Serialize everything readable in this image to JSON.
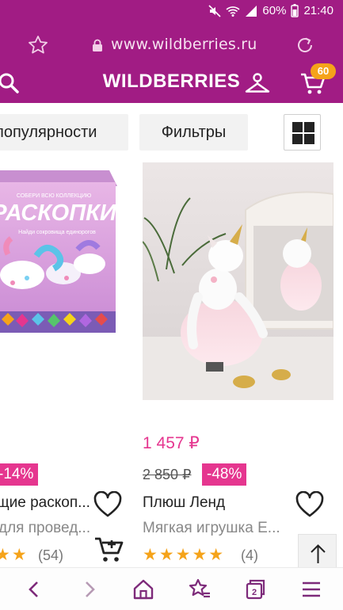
{
  "status_bar": {
    "battery": "60%",
    "time": "21:40"
  },
  "browser": {
    "url": "www.wildberries.ru"
  },
  "header": {
    "title": "WILDBERRIES",
    "cart_count": "60"
  },
  "controls": {
    "sort_label": "популярности",
    "filter_label": "Фильтры"
  },
  "products": [
    {
      "image_title": "РАСКОПКИ",
      "image_top_text": "СОБЕРИ ВСЮ КОЛЛЕКЦИЮ",
      "image_subtitle": "Найди сокровища единорогов",
      "discount": "-14%",
      "brand": "щие раскоп...",
      "name": "для провед...",
      "rating_stars": "★★",
      "reviews": "(54)"
    },
    {
      "price": "1 457 ₽",
      "old_price": "2 850 ₽",
      "discount": "-48%",
      "brand": "Плюш Ленд",
      "name": "Мягкая игрушка Е...",
      "rating_stars": "★★★★★",
      "reviews": "(4)"
    }
  ],
  "colors": {
    "brand_purple": "#a11c84",
    "price_pink": "#e5368f",
    "star_orange": "#f5a31a"
  },
  "icons": {
    "status": [
      "mute-icon",
      "wifi-icon",
      "signal-icon",
      "battery-icon"
    ],
    "browser": [
      "star-icon",
      "lock-icon",
      "reload-icon"
    ],
    "header": [
      "search-icon",
      "profile-icon",
      "cart-icon"
    ],
    "bottom_nav": [
      "back-icon",
      "forward-icon",
      "home-icon",
      "bookmarks-icon",
      "tabs-icon",
      "menu-icon"
    ]
  },
  "bottom_nav": {
    "tabs_count": "2"
  }
}
